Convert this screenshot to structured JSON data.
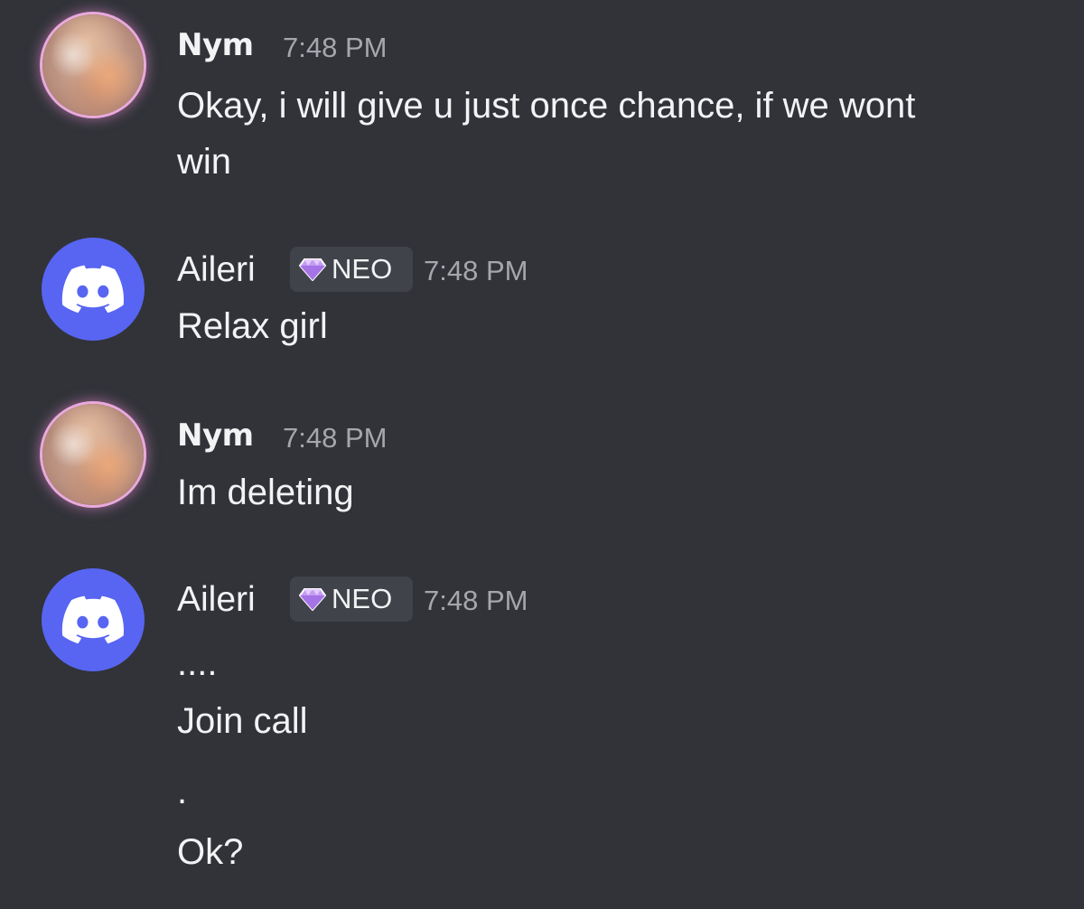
{
  "messages": [
    {
      "author": "Nym",
      "timestamp": "7:48 PM",
      "lines": [
        "Okay, i will give u just once chance, if we wont",
        "win"
      ]
    },
    {
      "author": "Aileri",
      "tag": "NEO",
      "timestamp": "7:48 PM",
      "lines": [
        "Relax girl"
      ]
    },
    {
      "author": "Nym",
      "timestamp": "7:48 PM",
      "lines": [
        "Im deleting"
      ]
    },
    {
      "author": "Aileri",
      "tag": "NEO",
      "timestamp": "7:48 PM",
      "lines": [
        "....",
        "Join call",
        ".",
        "Ok?"
      ]
    }
  ],
  "icons": {
    "nym_avatar": "profile-avatar-icon",
    "aileri_avatar": "discord-logo-icon",
    "tag_icon": "gem-icon"
  },
  "colors": {
    "background": "#313338",
    "discord_blurple": "#5865f2",
    "timestamp": "#a5a7ad",
    "tag_background": "#41434a"
  }
}
